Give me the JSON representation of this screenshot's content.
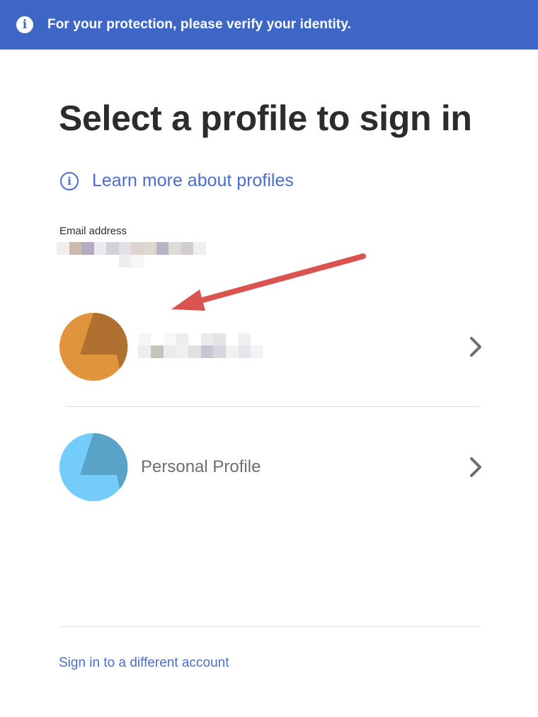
{
  "banner": {
    "icon": "info-icon",
    "text": "For your protection, please verify your identity.",
    "color": "#3d66c7"
  },
  "page": {
    "title": "Select a profile to sign in",
    "learn_more": {
      "icon": "info-circle-icon",
      "label": "Learn more about profiles"
    },
    "email": {
      "label": "Email address"
    }
  },
  "profiles": [
    {
      "name": "",
      "name_redacted": true,
      "avatar_color": "#e0953c",
      "avatar_accent": "#b07030",
      "icon": "chevron-right-icon"
    },
    {
      "name": "Personal Profile",
      "name_redacted": false,
      "avatar_color": "#74ccfa",
      "avatar_accent": "#5aa3c8",
      "icon": "chevron-right-icon"
    }
  ],
  "footer": {
    "different_account": "Sign in to a different account"
  },
  "annotation": {
    "arrow_color": "#d9534f"
  },
  "colors": {
    "link": "#4a6fd1",
    "title": "#2c2c2c"
  }
}
